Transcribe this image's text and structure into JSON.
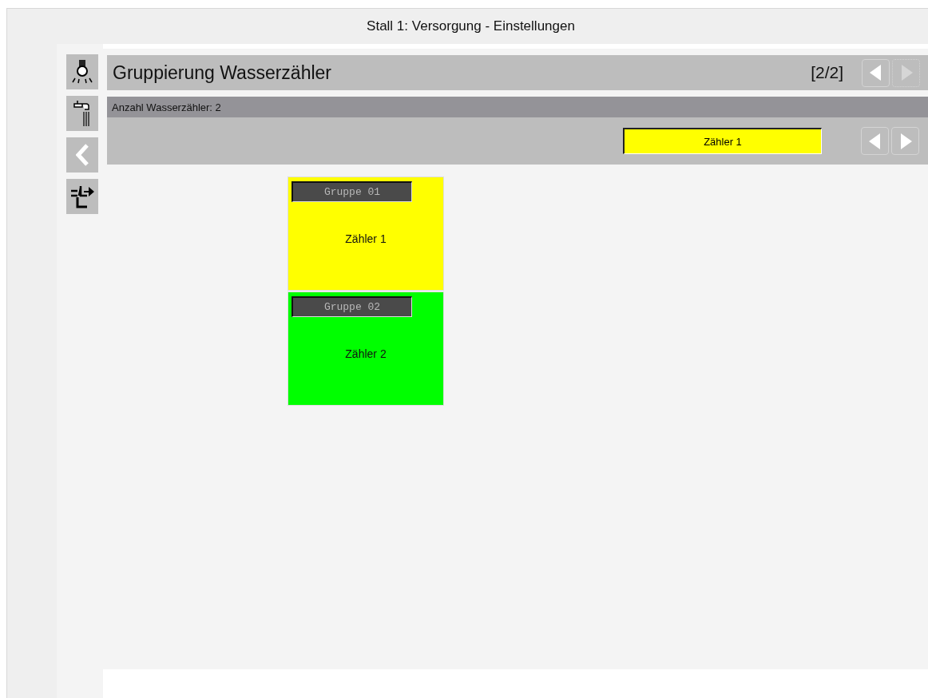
{
  "window": {
    "title": "Stall 1: Versorgung - Einstellungen"
  },
  "sidebar": {
    "items": [
      {
        "kind": "lamp"
      },
      {
        "kind": "tap"
      },
      {
        "kind": "back"
      },
      {
        "kind": "exit"
      }
    ]
  },
  "header": {
    "title": "Gruppierung Wasserzähler",
    "page": "[2/2]",
    "nav": [
      {
        "kind": "prev",
        "disabled": false
      },
      {
        "kind": "next",
        "disabled": true
      }
    ]
  },
  "info": {
    "label": "Anzahl Wasserzähler: 2"
  },
  "selector": {
    "value": "Zähler 1",
    "color": "#ffff00",
    "nav": [
      {
        "kind": "prev",
        "disabled": false
      },
      {
        "kind": "next",
        "disabled": false
      }
    ]
  },
  "groups": [
    {
      "group": "Gruppe 01",
      "meter": "Zähler 1",
      "color": "#ffff00"
    },
    {
      "group": "Gruppe 02",
      "meter": "Zähler 2",
      "color": "#00ff00"
    }
  ]
}
